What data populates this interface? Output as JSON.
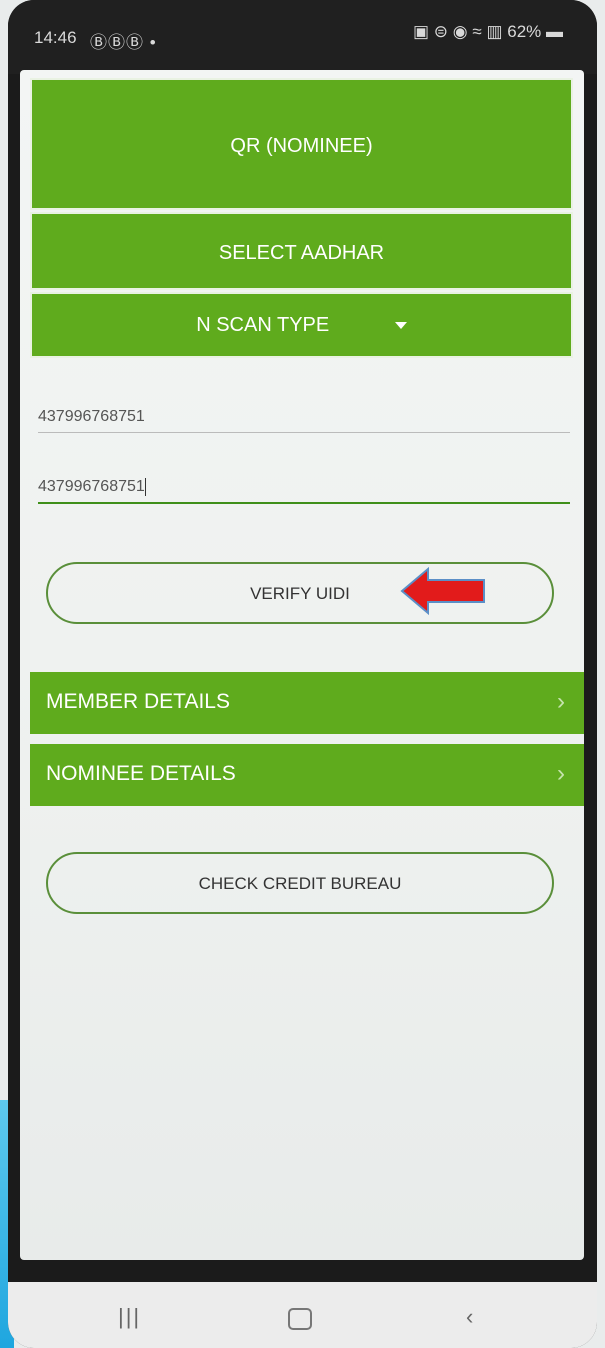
{
  "status_bar": {
    "time": "14:46",
    "notification_icons": "ⒷⒷⒷ •",
    "battery": "62%"
  },
  "buttons": {
    "qr_nominee": "QR (NOMINEE)",
    "select_aadhar": "SELECT AADHAR",
    "scan_type": "N SCAN TYPE",
    "verify_uidi": "VERIFY UIDI",
    "check_credit": "CHECK CREDIT BUREAU"
  },
  "fields": {
    "aadhar_number": "437996768751",
    "confirm_aadhar_number": "437996768751"
  },
  "sections": {
    "member": "MEMBER DETAILS",
    "nominee": "NOMINEE DETAILS"
  },
  "colors": {
    "accent_green": "#5fab1d",
    "annotation_arrow": "#e21b1b"
  },
  "icons": {
    "dropdown": "caret-down-icon",
    "section_chevron": "chevron-right-icon",
    "annotation": "red-arrow-icon"
  }
}
